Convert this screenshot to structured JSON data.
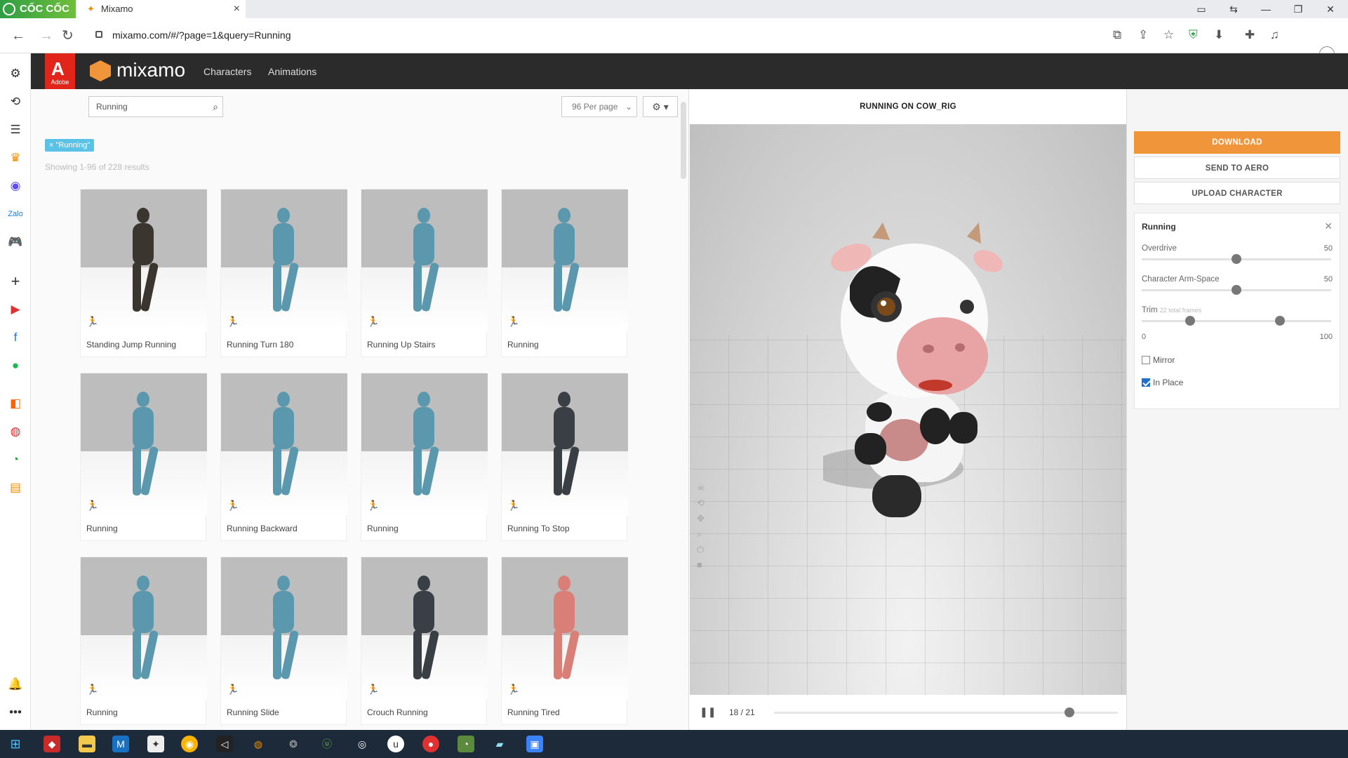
{
  "browser": {
    "logo": "CỐC CỐC",
    "tab_title": "Mixamo",
    "url": "mixamo.com/#/?page=1&query=Running"
  },
  "app": {
    "brand": "Adobe",
    "name": "mixamo",
    "nav": [
      "Characters",
      "Animations"
    ]
  },
  "toolbar": {
    "search_value": "Running",
    "per_page": "96 Per page"
  },
  "filter": {
    "chip": "× \"Running\"",
    "results": "Showing 1-96 of 228 results"
  },
  "animations": [
    {
      "label": "Standing Jump Running",
      "color": "#3b3530"
    },
    {
      "label": "Running Turn 180",
      "color": "#5b98ad"
    },
    {
      "label": "Running Up Stairs",
      "color": "#5b98ad"
    },
    {
      "label": "Running",
      "color": "#5b98ad"
    },
    {
      "label": "Running",
      "color": "#5b98ad"
    },
    {
      "label": "Running Backward",
      "color": "#5b98ad"
    },
    {
      "label": "Running",
      "color": "#5b98ad"
    },
    {
      "label": "Running To Stop",
      "color": "#3a3f45"
    },
    {
      "label": "Running",
      "color": "#5b98ad"
    },
    {
      "label": "Running Slide",
      "color": "#5b98ad"
    },
    {
      "label": "Crouch Running",
      "color": "#3a3f45"
    },
    {
      "label": "Running Tired",
      "color": "#d97f78"
    }
  ],
  "viewer": {
    "title": "RUNNING ON COW_RIG",
    "frames": "18 / 21",
    "progress": 0.86
  },
  "actions": {
    "download": "DOWNLOAD",
    "aero": "SEND TO AERO",
    "upload": "UPLOAD CHARACTER"
  },
  "settings": {
    "title": "Running",
    "overdrive_label": "Overdrive",
    "overdrive_value": "50",
    "armspace_label": "Character Arm-Space",
    "armspace_value": "50",
    "trim_label": "Trim",
    "trim_hint": "22 total frames",
    "trim_min": "0",
    "trim_max": "100",
    "trim_range": [
      0,
      100
    ],
    "mirror_label": "Mirror",
    "mirror_checked": false,
    "inplace_label": "In Place",
    "inplace_checked": true
  },
  "colors": {
    "accent": "#f1953b",
    "adobe_red": "#e1251b",
    "header": "#2b2b2b",
    "chip": "#5bc2e7"
  }
}
